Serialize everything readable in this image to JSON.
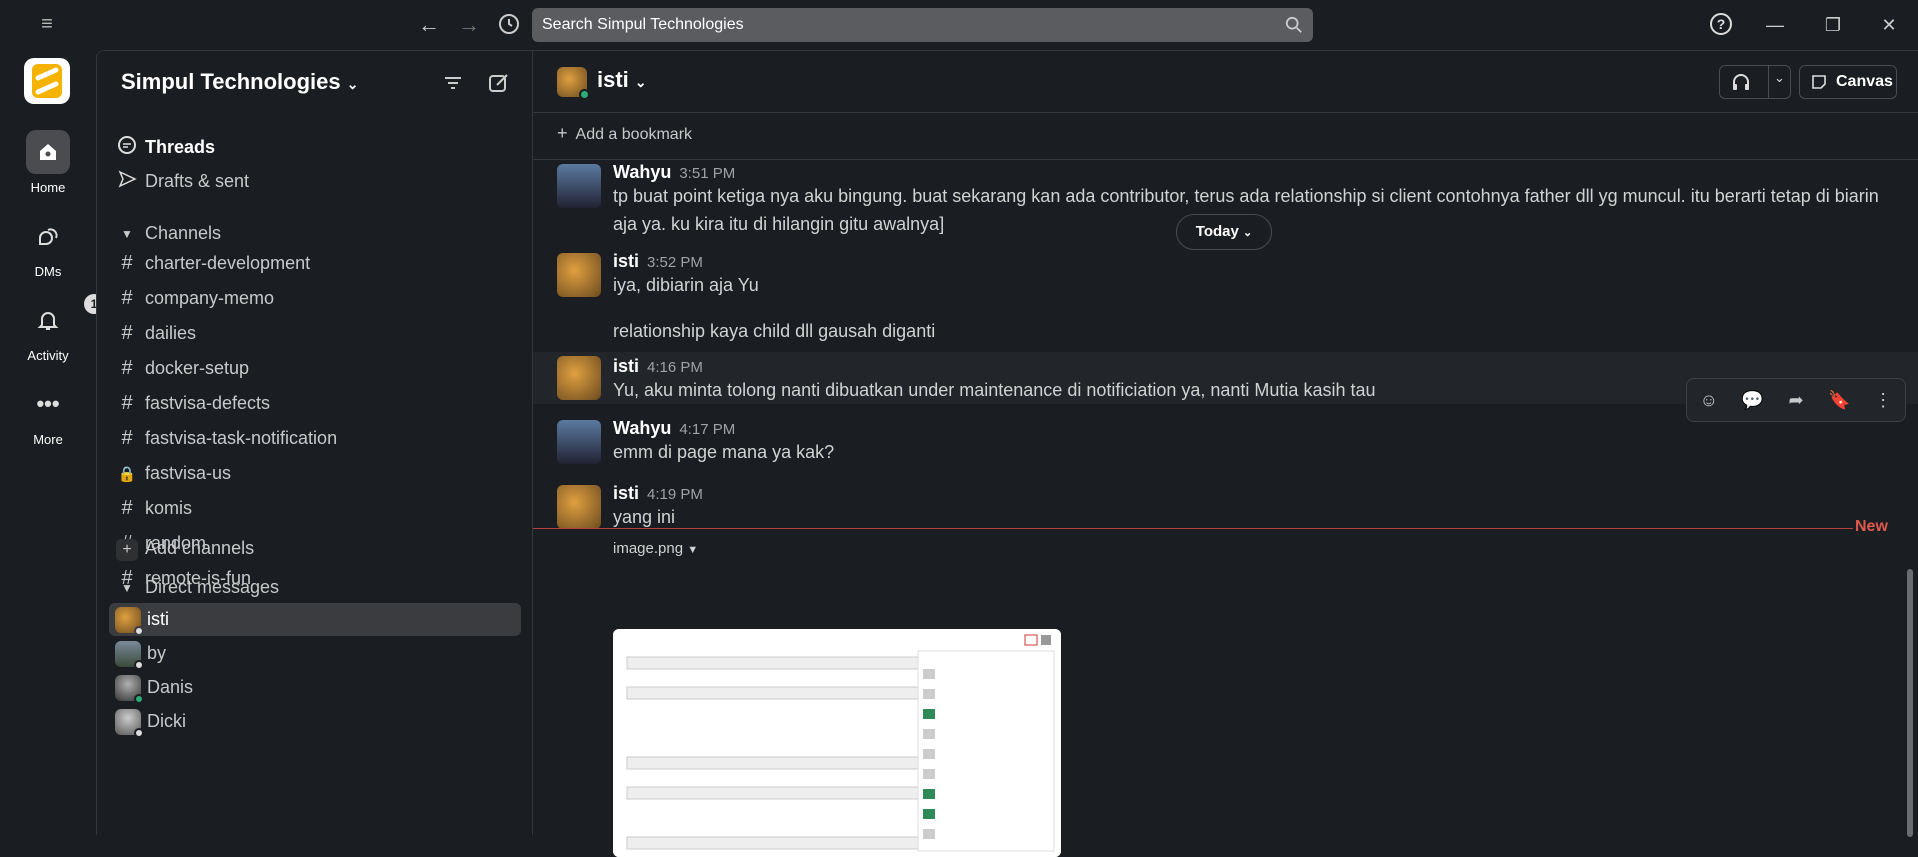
{
  "topbar": {
    "search_placeholder": "Search Simpul Technologies"
  },
  "rail": {
    "items": [
      {
        "label": "Home"
      },
      {
        "label": "DMs"
      },
      {
        "label": "Activity",
        "badge": "1"
      },
      {
        "label": "More"
      }
    ]
  },
  "sidebar": {
    "workspace": "Simpul Technologies",
    "threads": "Threads",
    "drafts": "Drafts & sent",
    "channels_header": "Channels",
    "channels": [
      {
        "name": "charter-development",
        "icon": "hash"
      },
      {
        "name": "company-memo",
        "icon": "hash"
      },
      {
        "name": "dailies",
        "icon": "hash"
      },
      {
        "name": "docker-setup",
        "icon": "hash"
      },
      {
        "name": "fastvisa-defects",
        "icon": "hash"
      },
      {
        "name": "fastvisa-task-notification",
        "icon": "hash"
      },
      {
        "name": "fastvisa-us",
        "icon": "lock"
      },
      {
        "name": "komis",
        "icon": "hash"
      },
      {
        "name": "random",
        "icon": "hash"
      },
      {
        "name": "remote-is-fun",
        "icon": "hash"
      }
    ],
    "add_channels": "Add channels",
    "dm_header": "Direct messages",
    "dms": [
      {
        "name": "isti"
      },
      {
        "name": "by"
      },
      {
        "name": "Danis"
      },
      {
        "name": "Dicki"
      }
    ]
  },
  "channel": {
    "name": "isti",
    "add_bookmark": "Add a bookmark",
    "canvas": "Canvas",
    "today": "Today",
    "new_label": "New"
  },
  "messages": [
    {
      "author": "Wahyu",
      "time": "3:51 PM",
      "lines": [
        "tp buat point ketiga nya aku bingung. buat sekarang kan ada contributor, terus ada relationship si client contohnya father dll yg muncul. itu berarti tetap di biarin aja ya. ku kira itu di hilangin gitu awalnya]"
      ]
    },
    {
      "author": "isti",
      "time": "3:52 PM",
      "lines": [
        "iya, dibiarin aja Yu",
        "relationship kaya child dll gausah diganti"
      ]
    },
    {
      "author": "isti",
      "time": "4:16 PM",
      "lines": [
        "Yu, aku minta tolong nanti dibuatkan under maintenance di notificiation ya, nanti Mutia kasih tau"
      ]
    },
    {
      "author": "Wahyu",
      "time": "4:17 PM",
      "lines": [
        "emm di page mana ya kak?"
      ]
    },
    {
      "author": "isti",
      "time": "4:19 PM",
      "lines": [
        "yang ini"
      ],
      "attachment": "image.png"
    }
  ]
}
